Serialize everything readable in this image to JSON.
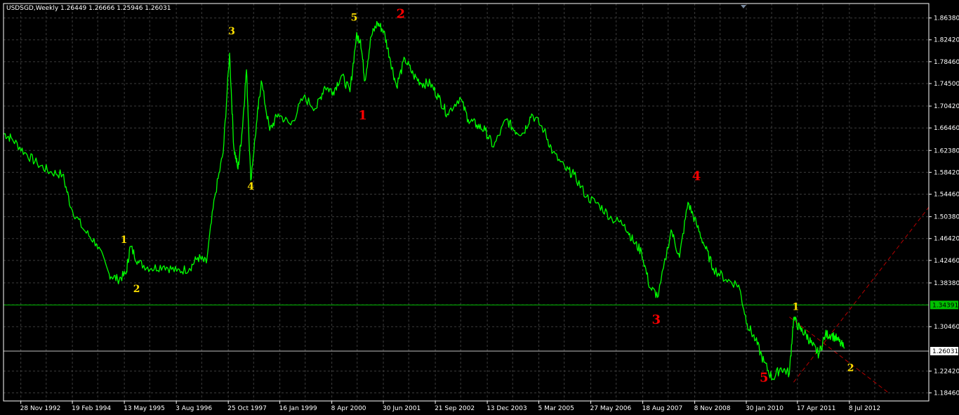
{
  "chart_header": "USDSGD,Weekly  1.26449 1.26666 1.25946 1.26031",
  "colors": {
    "background": "#000000",
    "grid": "#3c3c3c",
    "frame": "#ffffff",
    "price_line": "#00ff00",
    "hline": "#00c000",
    "trendline": "#b40000",
    "label_yellow": "#ffe000",
    "label_red": "#ff0000",
    "current_price_box": "#ffffff"
  },
  "chart_data": {
    "type": "line",
    "title": "USDSGD,Weekly",
    "ohlc_last": {
      "open": 1.26449,
      "high": 1.26666,
      "low": 1.25946,
      "close": 1.26031
    },
    "y_ticks": [
      1.8638,
      1.8242,
      1.7846,
      1.745,
      1.7042,
      1.6646,
      1.6238,
      1.5842,
      1.5446,
      1.5038,
      1.4642,
      1.4246,
      1.3838,
      1.3046,
      1.2242,
      1.1846
    ],
    "x_ticks": [
      "28 Nov 1992",
      "19 Feb 1994",
      "13 May 1995",
      "3 Aug 1996",
      "25 Oct 1997",
      "16 Jan 1999",
      "8 Apr 2000",
      "30 Jun 2001",
      "21 Sep 2002",
      "13 Dec 2003",
      "5 Mar 2005",
      "27 May 2006",
      "18 Aug 2007",
      "8 Nov 2008",
      "30 Jan 2010",
      "17 Apr 2011",
      "8 Jul 2012"
    ],
    "x_tick_years": [
      1992.91,
      1994.13,
      1995.36,
      1996.59,
      1997.82,
      1999.04,
      2000.27,
      2001.49,
      2002.72,
      2003.95,
      2005.17,
      2006.4,
      2007.63,
      2008.86,
      2010.08,
      2011.29,
      2012.52
    ],
    "ylim": [
      1.17,
      1.89
    ],
    "xlim": [
      1992.5,
      2014.4
    ],
    "series": [
      {
        "x": [
          1992.5,
          1992.7,
          1993.0,
          1993.3,
          1993.6,
          1993.9,
          1994.1,
          1994.4,
          1994.7,
          1995.0,
          1995.2,
          1995.4,
          1995.5,
          1995.7,
          1996.0,
          1996.3,
          1996.6,
          1996.9,
          1997.1,
          1997.3,
          1997.5,
          1997.7,
          1997.85,
          1997.95,
          1998.05,
          1998.15,
          1998.25,
          1998.35,
          1998.5,
          1998.6,
          1998.8,
          1999.0,
          1999.3,
          1999.6,
          1999.9,
          2000.1,
          2000.3,
          2000.5,
          2000.7,
          2000.85,
          2000.95,
          2001.05,
          2001.2,
          2001.35,
          2001.5,
          2001.65,
          2001.8,
          2002.0,
          2002.2,
          2002.4,
          2002.6,
          2002.8,
          2003.0,
          2003.3,
          2003.5,
          2003.7,
          2003.9,
          2004.1,
          2004.4,
          2004.6,
          2004.8,
          2005.0,
          2005.3,
          2005.5,
          2005.8,
          2006.0,
          2006.3,
          2006.6,
          2006.9,
          2007.2,
          2007.4,
          2007.6,
          2007.8,
          2008.0,
          2008.3,
          2008.5,
          2008.7,
          2008.9,
          2009.1,
          2009.3,
          2009.6,
          2009.9,
          2010.1,
          2010.3,
          2010.5,
          2010.7,
          2010.9,
          2011.1,
          2011.2,
          2011.35,
          2011.5,
          2011.65,
          2011.8,
          2011.95,
          2012.1,
          2012.25,
          2012.4
        ],
        "y": [
          1.655,
          1.645,
          1.62,
          1.6,
          1.585,
          1.58,
          1.52,
          1.48,
          1.455,
          1.4,
          1.39,
          1.4,
          1.45,
          1.42,
          1.41,
          1.415,
          1.405,
          1.41,
          1.43,
          1.42,
          1.54,
          1.62,
          1.8,
          1.63,
          1.59,
          1.66,
          1.77,
          1.57,
          1.68,
          1.75,
          1.66,
          1.69,
          1.67,
          1.72,
          1.7,
          1.74,
          1.73,
          1.76,
          1.73,
          1.83,
          1.825,
          1.75,
          1.83,
          1.855,
          1.84,
          1.79,
          1.74,
          1.79,
          1.76,
          1.745,
          1.745,
          1.72,
          1.69,
          1.72,
          1.68,
          1.67,
          1.66,
          1.63,
          1.68,
          1.66,
          1.655,
          1.69,
          1.66,
          1.62,
          1.59,
          1.58,
          1.54,
          1.525,
          1.5,
          1.49,
          1.46,
          1.44,
          1.375,
          1.36,
          1.48,
          1.43,
          1.53,
          1.49,
          1.45,
          1.41,
          1.39,
          1.38,
          1.31,
          1.28,
          1.24,
          1.21,
          1.23,
          1.22,
          1.32,
          1.3,
          1.29,
          1.27,
          1.255,
          1.29,
          1.29,
          1.28,
          1.265
        ]
      }
    ],
    "hlines": [
      {
        "price": 1.34391,
        "label": "1.34391"
      },
      {
        "price": 1.26031,
        "label": "1.26031"
      }
    ],
    "trendlines": [
      {
        "from": [
          2011.2,
          1.204
        ],
        "to": [
          2014.4,
          1.521
        ]
      },
      {
        "from": [
          2011.1,
          1.322
        ],
        "to": [
          2013.45,
          1.1846
        ]
      }
    ],
    "annotations": [
      {
        "text": "1",
        "x": 1995.35,
        "y": 1.456,
        "color": "yellow",
        "size": 14
      },
      {
        "text": "2",
        "x": 1995.65,
        "y": 1.367,
        "color": "yellow",
        "size": 14
      },
      {
        "text": "3",
        "x": 1997.9,
        "y": 1.834,
        "color": "yellow",
        "size": 14
      },
      {
        "text": "4",
        "x": 1998.35,
        "y": 1.553,
        "color": "yellow",
        "size": 14
      },
      {
        "text": "5",
        "x": 2000.8,
        "y": 1.859,
        "color": "yellow",
        "size": 14
      },
      {
        "text": "1",
        "x": 2001.0,
        "y": 1.68,
        "color": "red",
        "size": 18
      },
      {
        "text": "2",
        "x": 2001.9,
        "y": 1.864,
        "color": "red",
        "size": 18
      },
      {
        "text": "3",
        "x": 2007.95,
        "y": 1.31,
        "color": "red",
        "size": 18
      },
      {
        "text": "4",
        "x": 2008.9,
        "y": 1.57,
        "color": "red",
        "size": 18
      },
      {
        "text": "5",
        "x": 2010.5,
        "y": 1.205,
        "color": "red",
        "size": 18
      },
      {
        "text": "1",
        "x": 2011.25,
        "y": 1.335,
        "color": "yellow",
        "size": 14
      },
      {
        "text": "2",
        "x": 2012.55,
        "y": 1.224,
        "color": "yellow",
        "size": 14
      }
    ]
  }
}
